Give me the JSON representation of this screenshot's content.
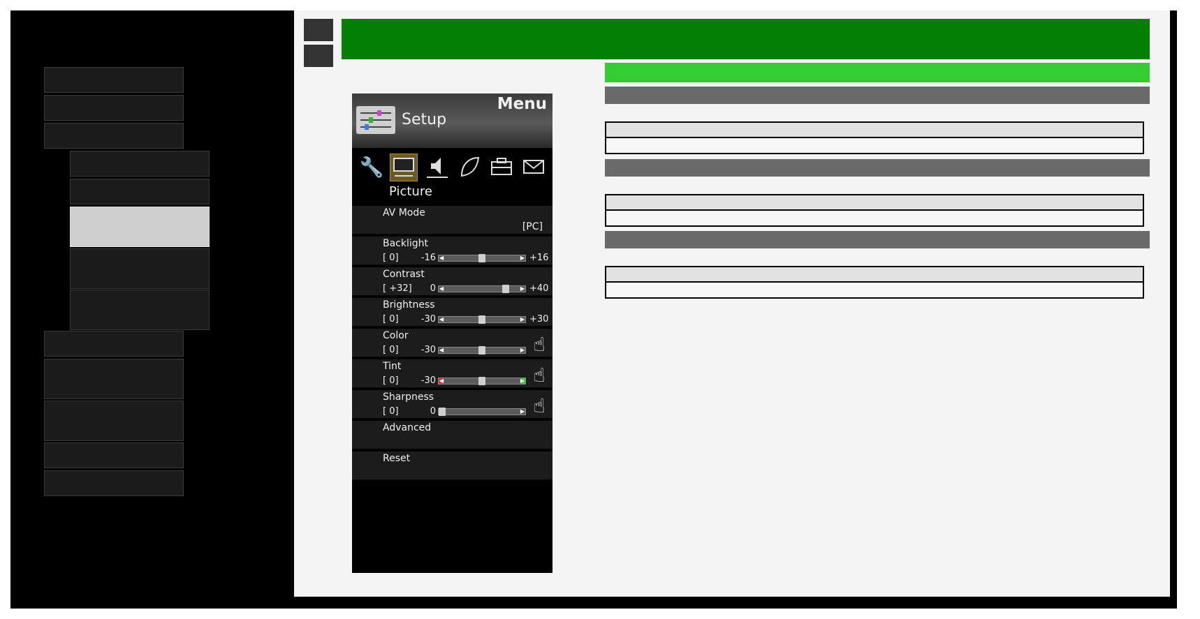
{
  "tv_menu": {
    "menu_label": "Menu",
    "setup_label": "Setup",
    "category_label": "Picture",
    "icons": [
      "wrench-icon",
      "picture-icon",
      "speaker-icon",
      "leaf-icon",
      "toolbox-icon",
      "envelope-icon"
    ],
    "items": [
      {
        "label": "AV Mode",
        "value": "[PC]"
      },
      {
        "label": "Backlight",
        "current": "[    0]",
        "min": "-16",
        "max": "+16",
        "level": 0.5
      },
      {
        "label": "Contrast",
        "current": "[ +32]",
        "min": "0",
        "max": "+40",
        "level": 0.8
      },
      {
        "label": "Brightness",
        "current": "[    0]",
        "min": "-30",
        "max": "+30",
        "level": 0.5
      },
      {
        "label": "Color",
        "current": "[    0]",
        "min": "-30",
        "max": "",
        "level": 0.5
      },
      {
        "label": "Tint",
        "current": "[    0]",
        "min": "-30",
        "max": "",
        "level": 0.5
      },
      {
        "label": "Sharpness",
        "current": "[    0]",
        "min": "0",
        "max": "",
        "level": 0.0
      },
      {
        "label": "Advanced"
      },
      {
        "label": "Reset"
      }
    ]
  },
  "colors": {
    "banner": "#037f03",
    "accent": "#33cc33",
    "section_bar": "#6a6a6a",
    "tint_left": "#e23030",
    "tint_right": "#33cc33"
  }
}
